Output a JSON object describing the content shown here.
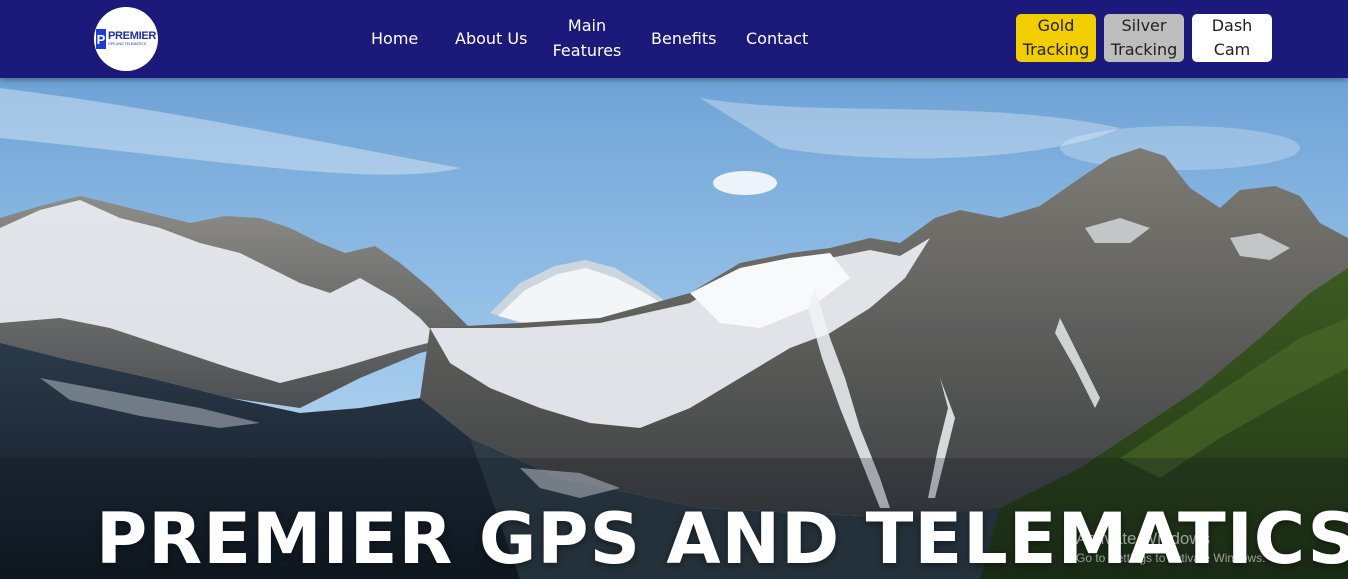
{
  "brand": {
    "logo_letter": "P",
    "logo_word": "PREMIER",
    "logo_sub": "GPS AND TELEMATICS"
  },
  "nav": {
    "home": "Home",
    "about": "About Us",
    "main_line1": "Main",
    "main_line2": "Features",
    "benefits": "Benefits",
    "contact": "Contact"
  },
  "plans": {
    "gold_line1": "Gold",
    "gold_line2": "Tracking",
    "silver_line1": "Silver",
    "silver_line2": "Tracking",
    "dash_line1": "Dash",
    "dash_line2": "Cam"
  },
  "hero": {
    "title": "PREMIER GPS AND TELEMATICS"
  },
  "watermark": {
    "title": "Activate Windows",
    "subtitle": "Go to Settings to activate Windows."
  },
  "colors": {
    "navbar": "#1b1a7a",
    "gold": "#f2cd00",
    "silver": "#bdbdbd",
    "white": "#ffffff"
  },
  "icons": {
    "logo": "premier-logo",
    "hero_image": "mountain-landscape-photo"
  }
}
